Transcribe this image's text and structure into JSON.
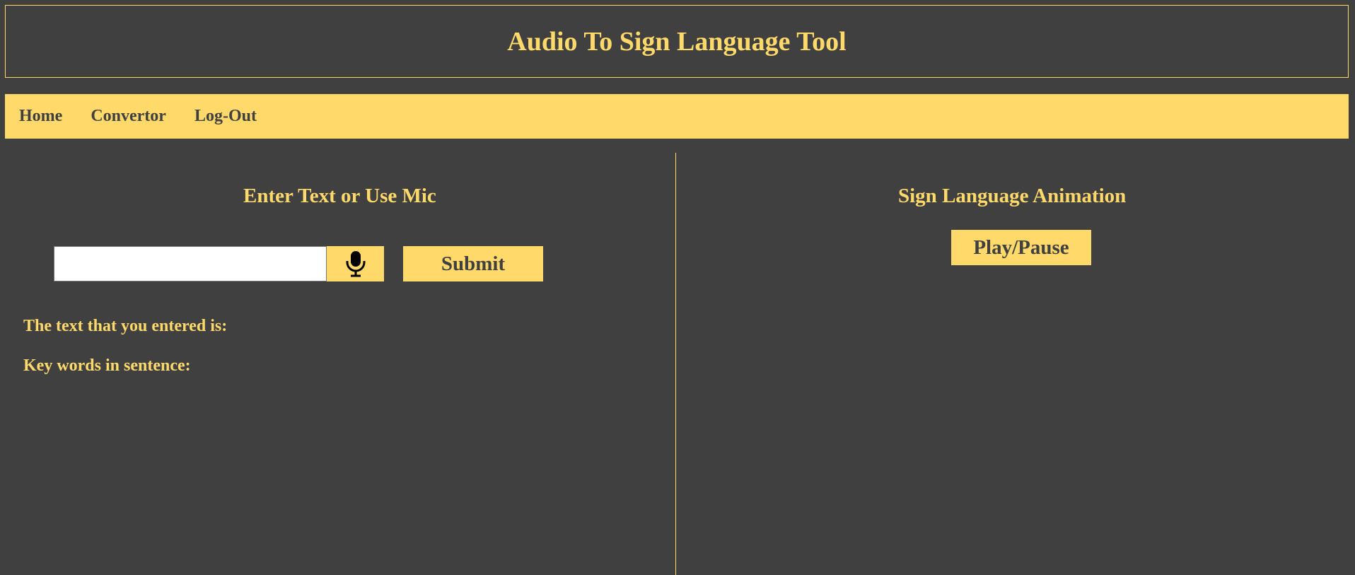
{
  "header": {
    "title": "Audio To Sign Language Tool"
  },
  "nav": {
    "items": [
      {
        "label": "Home"
      },
      {
        "label": "Convertor"
      },
      {
        "label": "Log-Out"
      }
    ]
  },
  "left": {
    "title": "Enter Text or Use Mic",
    "input": {
      "value": "",
      "placeholder": ""
    },
    "mic_icon": "microphone-icon",
    "submit_label": "Submit",
    "entered_text_label": "The text that you entered is:",
    "keywords_label": "Key words in sentence:"
  },
  "right": {
    "title": "Sign Language Animation",
    "play_label": "Play/Pause"
  },
  "colors": {
    "accent": "#ffda6a",
    "background": "#404040"
  }
}
